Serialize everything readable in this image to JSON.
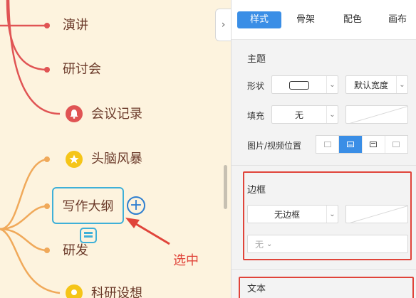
{
  "mindmap": {
    "nodes": {
      "lecture": "演讲",
      "seminar": "研讨会",
      "meeting_notes": "会议记录",
      "brainstorm": "头脑风暴",
      "writing_outline": "写作大纲",
      "research": "研发",
      "research_project": "科研设想"
    },
    "annotation": "选中",
    "colors": {
      "red_branch": "#e05454",
      "orange_branch": "#f0a95a",
      "selection": "#3fb0d8",
      "annotation": "#e0443a"
    }
  },
  "panel": {
    "tabs": [
      "样式",
      "骨架",
      "配色",
      "画布"
    ],
    "active_tab": "样式",
    "theme": {
      "title": "主题",
      "shape_label": "形状",
      "width_value": "默认宽度",
      "fill_label": "填充",
      "fill_value": "无",
      "media_label": "图片/视频位置"
    },
    "border": {
      "title": "边框",
      "style_value": "无边框",
      "width_value": "无"
    },
    "text": {
      "title": "文本"
    },
    "accent_color": "#3a8ee6",
    "highlight_color": "#e0443a"
  }
}
